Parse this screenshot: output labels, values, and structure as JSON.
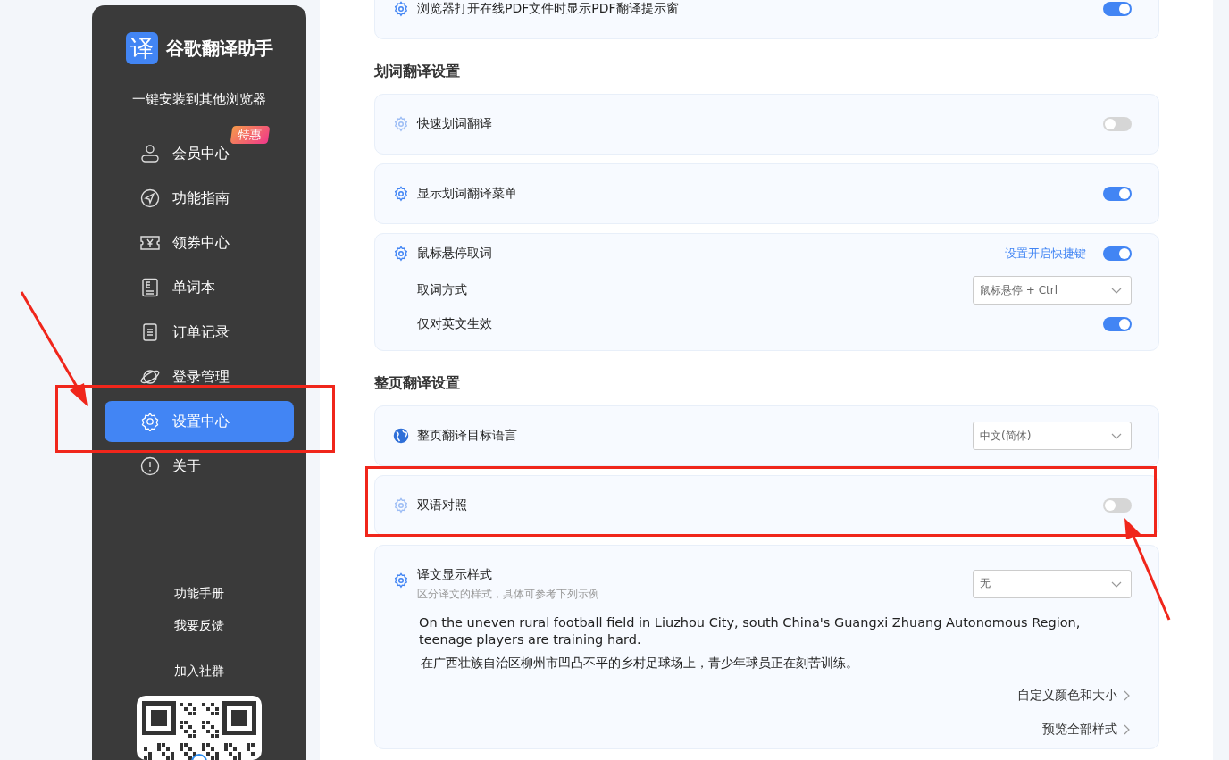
{
  "sidebar": {
    "logo_glyph": "译",
    "app_name": "谷歌翻译助手",
    "install_link": "一键安装到其他浏览器",
    "nav_items": [
      {
        "kind": "user",
        "label": "会员中心",
        "selected": false,
        "badge": "特惠"
      },
      {
        "kind": "guide",
        "label": "功能指南",
        "selected": false
      },
      {
        "kind": "coupon",
        "label": "领券中心",
        "selected": false
      },
      {
        "kind": "wordbook",
        "label": "单词本",
        "selected": false
      },
      {
        "kind": "orders",
        "label": "订单记录",
        "selected": false
      },
      {
        "kind": "planet",
        "label": "登录管理",
        "selected": false
      },
      {
        "kind": "settings",
        "label": "设置中心",
        "selected": true
      },
      {
        "kind": "about",
        "label": "关于",
        "selected": false
      }
    ],
    "footer_links": [
      "功能手册",
      "我要反馈"
    ],
    "community_label": "加入社群"
  },
  "sections": [
    {
      "cards": [
        {
          "rows": [
            {
              "kind": "toggle",
              "label": "浏览器打开在线PDF文件时显示PDF翻译提示窗",
              "on": true
            }
          ]
        }
      ]
    },
    {
      "title": "划词翻译设置",
      "cards": [
        {
          "rows": [
            {
              "kind": "toggle",
              "label": "快速划词翻译",
              "on": false
            }
          ]
        },
        {
          "rows": [
            {
              "kind": "toggle",
              "label": "显示划词翻译菜单",
              "on": true
            }
          ]
        },
        {
          "rows": [
            {
              "kind": "toggle",
              "label": "鼠标悬停取词",
              "on": true,
              "link": "设置开启快捷键"
            },
            {
              "kind": "select",
              "label": "取词方式",
              "value": "鼠标悬停 + Ctrl"
            },
            {
              "kind": "toggle",
              "label": "仅对英文生效",
              "on": true
            }
          ]
        }
      ]
    },
    {
      "title": "整页翻译设置",
      "cards": [
        {
          "rows": [
            {
              "kind": "select",
              "label": "整页翻译目标语言",
              "value": "中文(简体)"
            }
          ]
        },
        {
          "rows": [
            {
              "kind": "toggle",
              "label": "双语对照",
              "on": false
            }
          ]
        },
        {
          "rows": [
            {
              "kind": "style",
              "label": "译文显示样式",
              "hint": "区分译文的样式，具体可参考下列示例",
              "value": "无",
              "sample_en": "On the uneven rural football field in Liuzhou City, south China's Guangxi Zhuang Autonomous Region, teenage players are training hard.",
              "sample_zh": "在广西壮族自治区柳州市凹凸不平的乡村足球场上，青少年球员正在刻苦训练。",
              "links": [
                "自定义颜色和大小",
                "预览全部样式"
              ]
            }
          ]
        }
      ]
    }
  ]
}
